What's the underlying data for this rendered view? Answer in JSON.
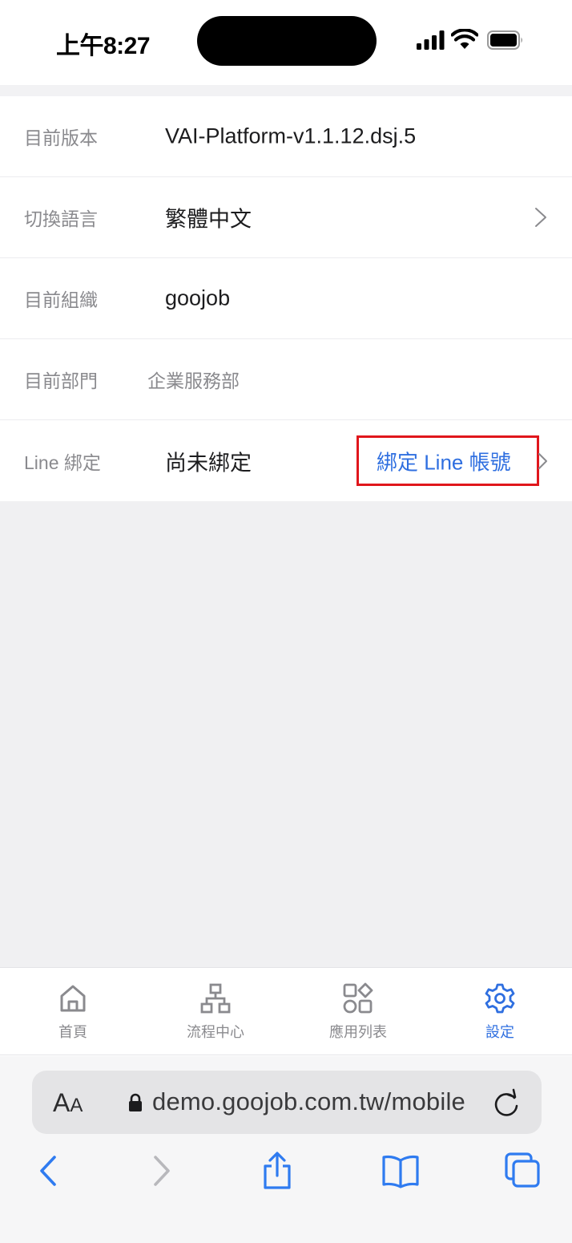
{
  "status_bar": {
    "time": "上午8:27"
  },
  "settings": {
    "version": {
      "label": "目前版本",
      "value": "VAI-Platform-v1.1.12.dsj.5"
    },
    "language": {
      "label": "切換語言",
      "value": "繁體中文"
    },
    "organization": {
      "label": "目前組織",
      "value": "goojob"
    },
    "department": {
      "label": "目前部門",
      "value": "企業服務部"
    },
    "line": {
      "label": "Line 綁定",
      "value": "尚未綁定",
      "action": "綁定 Line 帳號"
    }
  },
  "tabs": [
    {
      "label": "首頁",
      "icon": "home-icon"
    },
    {
      "label": "流程中心",
      "icon": "flow-icon"
    },
    {
      "label": "應用列表",
      "icon": "apps-icon"
    },
    {
      "label": "設定",
      "icon": "gear-icon",
      "active": true
    }
  ],
  "browser": {
    "aa_label": "A",
    "aa_small": "A",
    "url": "demo.goojob.com.tw/mobile"
  },
  "colors": {
    "accent": "#2f6fe0",
    "highlight_box": "#e0161c",
    "background": "#f0f0f2"
  }
}
